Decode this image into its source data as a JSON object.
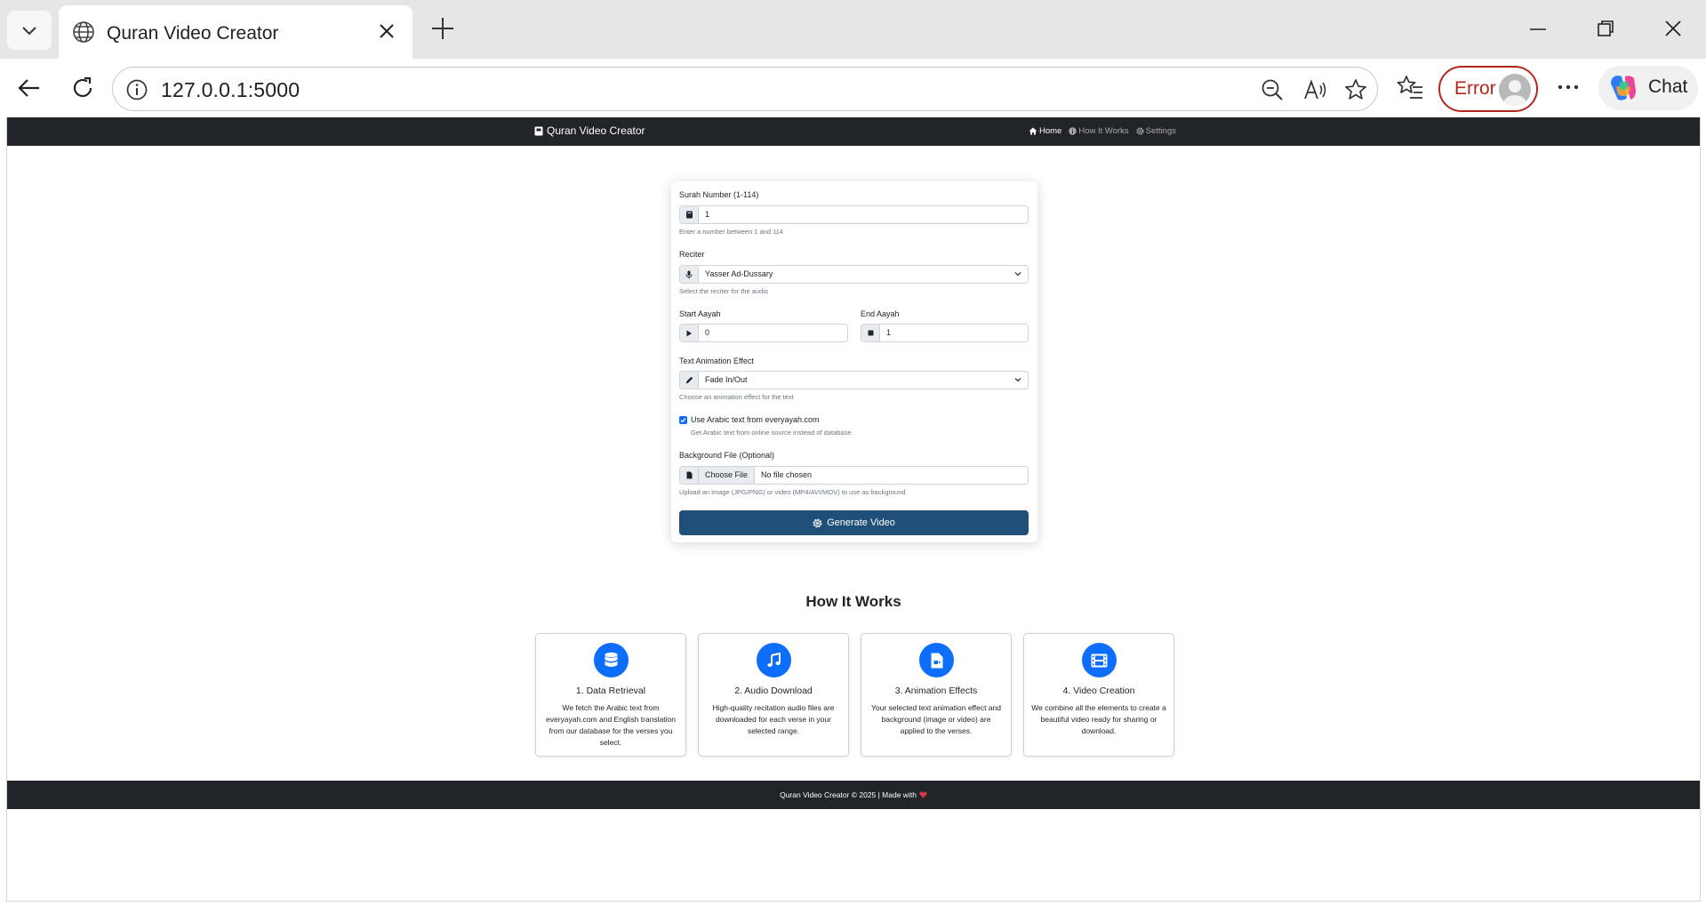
{
  "browser": {
    "tab_title": "Quran Video Creator",
    "url": "127.0.0.1:5000",
    "error_label": "Error",
    "chat_label": "Chat"
  },
  "site": {
    "brand": "Quran Video Creator",
    "nav": {
      "home": "Home",
      "how": "How It Works",
      "settings": "Settings"
    }
  },
  "form": {
    "surah": {
      "label": "Surah Number (1-114)",
      "value": "1",
      "help": "Enter a number between 1 and 114"
    },
    "reciter": {
      "label": "Reciter",
      "value": "Yasser Ad-Dussary",
      "help": "Select the reciter for the audio"
    },
    "start": {
      "label": "Start Aayah",
      "value": "0"
    },
    "end": {
      "label": "End Aayah",
      "value": "1"
    },
    "animation": {
      "label": "Text Animation Effect",
      "value": "Fade In/Out",
      "help": "Choose an animation effect for the text"
    },
    "arabic_source": {
      "label": "Use Arabic text from everyayah.com",
      "checked": true,
      "help": "Get Arabic text from online source instead of database"
    },
    "background": {
      "label": "Background File (Optional)",
      "button": "Choose File",
      "status": "No file chosen",
      "help": "Upload an image (JPG/PNG) or video (MP4/AVI/MOV) to use as background"
    },
    "submit": "Generate Video"
  },
  "how_it_works": {
    "title": "How It Works",
    "steps": [
      {
        "title": "1. Data Retrieval",
        "text": "We fetch the Arabic text from everyayah.com and English translation from our database for the verses you select.",
        "icon": "database-icon"
      },
      {
        "title": "2. Audio Download",
        "text": "High-quality recitation audio files are downloaded for each verse in your selected range.",
        "icon": "music-icon"
      },
      {
        "title": "3. Animation Effects",
        "text": "Your selected text animation effect and background (image or video) are applied to the verses.",
        "icon": "file-video-icon"
      },
      {
        "title": "4. Video Creation",
        "text": "We combine all the elements to create a beautiful video ready for sharing or download.",
        "icon": "film-icon"
      }
    ]
  },
  "footer": {
    "text": "Quran Video Creator © 2025 | Made with"
  },
  "colors": {
    "dark": "#212529",
    "primary": "#0d6efd",
    "button": "#1f4e79",
    "heart": "#dc3545",
    "error": "#b3261e"
  }
}
